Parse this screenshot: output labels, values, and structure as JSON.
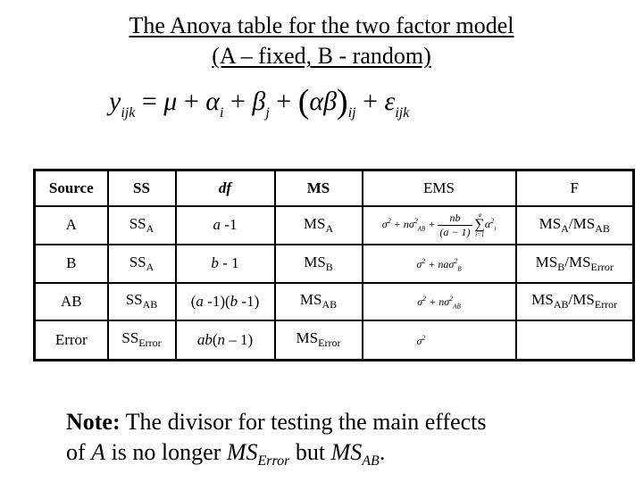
{
  "title": {
    "line1": "The Anova table for the two factor model",
    "line2": "(A – fixed, B - random)"
  },
  "equation": {
    "lhs": "y",
    "lhs_sub": "ijk",
    "eq": " = ",
    "mu": "μ",
    "plus": " + ",
    "alpha": "α",
    "alpha_sub": "i",
    "beta": "β",
    "beta_sub": "j",
    "interaction": "αβ",
    "interaction_sub": "ij",
    "epsilon": "ε",
    "epsilon_sub": "ijk"
  },
  "table": {
    "headers": {
      "source": "Source",
      "ss": "SS",
      "df": "df",
      "ms": "MS",
      "ems": "EMS",
      "f": "F"
    },
    "rows": [
      {
        "source": "A",
        "ss": "SS",
        "ss_sub": "A",
        "df_a": "a",
        "df_rest": " -1",
        "ms": "MS",
        "ms_sub": "A",
        "ems": {
          "sigma": "σ",
          "sq": "2",
          "plus": " + ",
          "n": "n",
          "sigma2": "σ",
          "sub2": "AB",
          "num": "nb",
          "den": "(a − 1)",
          "sum_top": "a",
          "sum_bottom": "i=1",
          "sum_sym": "∑",
          "alpha": "α",
          "alpha_sub": "i"
        },
        "f_num": "MS",
        "f_num_sub": "A",
        "f_slash": "/",
        "f_den": "MS",
        "f_den_sub": "AB"
      },
      {
        "source": "B",
        "ss": "SS",
        "ss_sub": "A",
        "df_a": "b",
        "df_rest": " - 1",
        "ms": "MS",
        "ms_sub": "B",
        "ems": {
          "sigma": "σ",
          "sq": "2",
          "plus": " + ",
          "n": "na",
          "sigma2": "σ",
          "sub2": "B"
        },
        "f_num": "MS",
        "f_num_sub": "B",
        "f_slash": "/",
        "f_den": "MS",
        "f_den_sub": "Error"
      },
      {
        "source": "AB",
        "ss": "SS",
        "ss_sub": "AB",
        "df_p1": "(",
        "df_a": "a",
        "df_mid": " -1)(",
        "df_b": "b",
        "df_end": " -1)",
        "ms": "MS",
        "ms_sub": "AB",
        "ems": {
          "sigma": "σ",
          "sq": "2",
          "plus": " + ",
          "n": "n",
          "sigma2": "σ",
          "sub2": "AB"
        },
        "f_num": "MS",
        "f_num_sub": "AB",
        "f_slash": "/",
        "f_den": "MS",
        "f_den_sub": "Error"
      },
      {
        "source": "Error",
        "ss": "SS",
        "ss_sub": "Error",
        "df_ab": "ab",
        "df_p": "(",
        "df_n": "n",
        "df_end": " – 1)",
        "ms": "MS",
        "ms_sub": "Error",
        "ems": {
          "sigma": "σ",
          "sq": "2"
        },
        "f": ""
      }
    ]
  },
  "note": {
    "label": "Note:",
    "line1": " The divisor for testing the main effects",
    "line2_pre": "of ",
    "line2_var": "A",
    "line2_mid": " is no longer ",
    "ms1": "MS",
    "ms1_sub": "Error",
    "line2_but": " but ",
    "ms2": "MS",
    "ms2_sub": "AB",
    "end": "."
  }
}
